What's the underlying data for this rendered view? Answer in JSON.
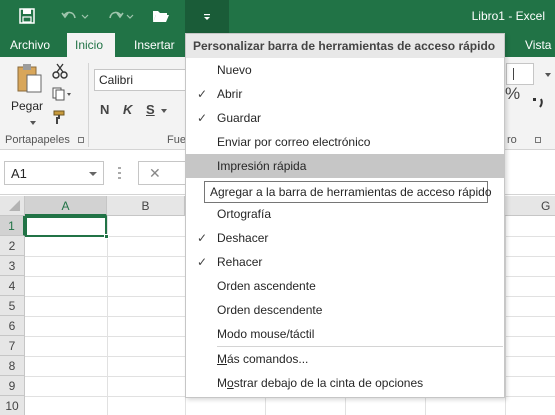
{
  "window": {
    "title": "Libro1 - Excel"
  },
  "quick_access": {
    "save_icon": "save-icon",
    "undo_icon": "undo-icon",
    "redo_icon": "redo-icon",
    "open_icon": "folder-open-icon",
    "customize_icon": "customize-dropdown-icon"
  },
  "tabs": [
    {
      "label": "Archivo"
    },
    {
      "label": "Inicio"
    },
    {
      "label": "Insertar"
    },
    {
      "label": "Vista"
    }
  ],
  "ribbon": {
    "paste_label": "Pegar",
    "clipboard_group": "Portapapeles",
    "font_name": "Calibri",
    "bold": "N",
    "italic": "K",
    "underline": "S",
    "font_group_partial": "Fue",
    "number_group_partial": "ro",
    "percent": "%"
  },
  "formula_bar": {
    "name_box": "A1",
    "cancel": "✕"
  },
  "grid": {
    "columns": [
      "A",
      "B",
      "G"
    ],
    "rows": [
      "1",
      "2",
      "3",
      "4",
      "5",
      "6",
      "7",
      "8",
      "9",
      "10"
    ]
  },
  "menu": {
    "header": "Personalizar barra de herramientas de acceso rápido",
    "items": [
      {
        "label": "Nuevo",
        "checked": false
      },
      {
        "label": "Abrir",
        "checked": true
      },
      {
        "label": "Guardar",
        "checked": true
      },
      {
        "label": "Enviar por correo electrónico",
        "checked": false
      },
      {
        "label": "Impresión rápida",
        "checked": false
      },
      {
        "label": "Ortografía",
        "checked": false
      },
      {
        "label": "Deshacer",
        "checked": true
      },
      {
        "label": "Rehacer",
        "checked": true
      },
      {
        "label": "Orden ascendente",
        "checked": false
      },
      {
        "label": "Orden descendente",
        "checked": false
      },
      {
        "label": "Modo mouse/táctil",
        "checked": false
      }
    ],
    "more_commands": {
      "prefix": "",
      "underlined": "M",
      "rest": "ás comandos..."
    },
    "show_below": {
      "prefix": "M",
      "underlined": "o",
      "rest": "strar debajo de la cinta de opciones"
    },
    "tooltip": "Agregar a la barra de herramientas de acceso rápido",
    "check_glyph": "✓"
  }
}
